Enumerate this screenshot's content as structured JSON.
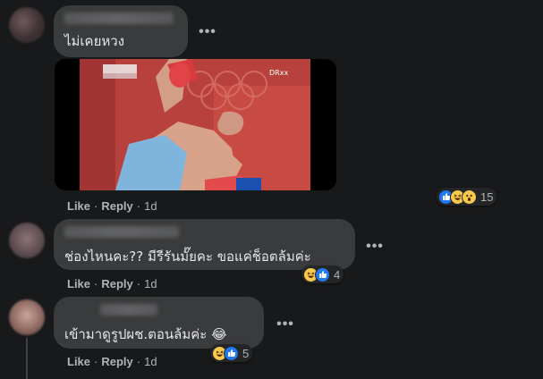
{
  "comments": [
    {
      "text": "ไม่เคยหวง",
      "actions": {
        "like": "Like",
        "reply": "Reply",
        "time": "1d"
      },
      "reactions": {
        "icons": [
          "like-icon",
          "haha-icon",
          "wow-icon"
        ],
        "count": "15"
      }
    },
    {
      "text": "ช่องไหนคะ?? มีรีรันมั๊ยคะ ขอแค่ช็อตล้มค่ะ",
      "actions": {
        "like": "Like",
        "reply": "Reply",
        "time": "1d"
      },
      "reactions": {
        "icons": [
          "haha-icon",
          "like-icon"
        ],
        "count": "4"
      }
    },
    {
      "text": "เข้ามาดูรูปผช.ตอนล้มค่ะ 😂",
      "actions": {
        "like": "Like",
        "reply": "Reply",
        "time": "1d"
      },
      "reactions": {
        "icons": [
          "haha-icon",
          "like-icon"
        ],
        "count": "5"
      }
    }
  ],
  "more_label": "•••",
  "colors": {
    "background": "#18191a",
    "bubble": "#3a3b3c",
    "like_blue": "#2078f4",
    "meta_text": "#b0b3b8"
  }
}
